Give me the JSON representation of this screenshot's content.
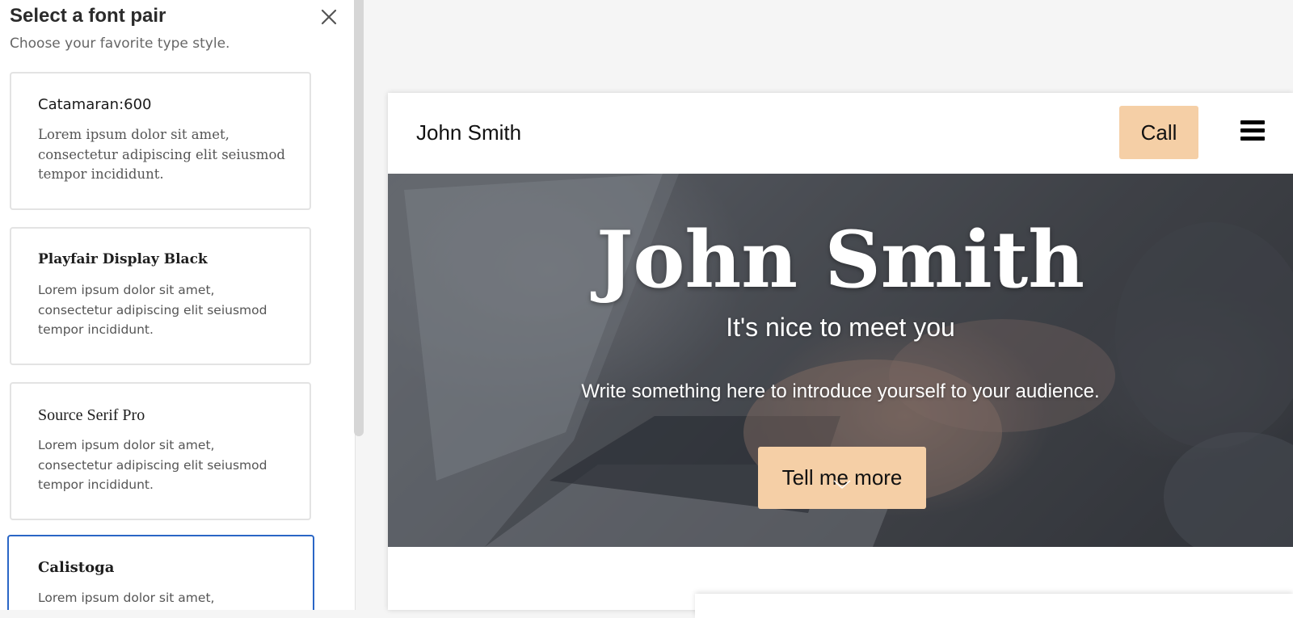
{
  "panel": {
    "title": "Select a font pair",
    "subtitle": "Choose your favorite type style.",
    "close_icon": "close-icon"
  },
  "fonts": [
    {
      "name": "Catamaran:600",
      "sample": "Lorem ipsum dolor sit amet, consectetur adipiscing elit seiusmod tempor incididunt.",
      "selected": false
    },
    {
      "name": "Playfair Display Black",
      "sample": "Lorem ipsum dolor sit amet, consectetur adipiscing elit seiusmod tempor incididunt.",
      "selected": false
    },
    {
      "name": "Source Serif Pro",
      "sample": "Lorem ipsum dolor sit amet, consectetur adipiscing elit seiusmod tempor incididunt.",
      "selected": false
    },
    {
      "name": "Calistoga",
      "sample": "Lorem ipsum dolor sit amet,",
      "selected": true
    }
  ],
  "preview": {
    "brand": "John Smith",
    "call_label": "Call",
    "menu_icon": "hamburger-menu-icon",
    "hero": {
      "title": "John Smith",
      "subtitle": "It's nice to meet you",
      "intro": "Write something here to introduce yourself to your audience.",
      "button_label": "Tell me more"
    }
  },
  "colors": {
    "accent_button": "#f5cfa6",
    "selected_border": "#2a66c6"
  }
}
